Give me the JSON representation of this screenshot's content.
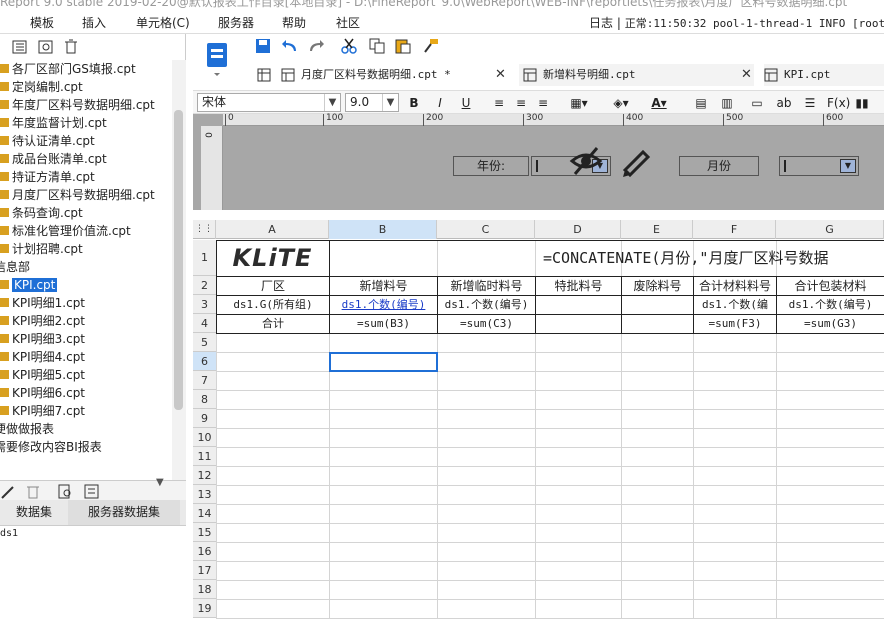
{
  "titlebar": {
    "text": "Report 9.0 stable 2019-02-20@默认报表工作目录[本地目录] - D:\\FineReport_9.0\\WebReport\\WEB-INF\\reportlets\\任务报表\\月度厂区料号数据明细.cpt"
  },
  "menu": {
    "items": [
      "模板",
      "插入",
      "单元格(C)",
      "服务器",
      "帮助",
      "社区"
    ]
  },
  "log": {
    "label": "日志",
    "sep": "|",
    "text": "正常:11:50:32 pool-1-thread-1 INFO [root]"
  },
  "tree": {
    "items": [
      {
        "label": "各厂区部门GS填报.cpt",
        "type": "file"
      },
      {
        "label": "定岗编制.cpt",
        "type": "file"
      },
      {
        "label": "年度厂区料号数据明细.cpt",
        "type": "file"
      },
      {
        "label": "年度监督计划.cpt",
        "type": "file"
      },
      {
        "label": "待认证清单.cpt",
        "type": "file"
      },
      {
        "label": "成品台账清单.cpt",
        "type": "file"
      },
      {
        "label": "持证方清单.cpt",
        "type": "file"
      },
      {
        "label": "月度厂区料号数据明细.cpt",
        "type": "file"
      },
      {
        "label": "条码查询.cpt",
        "type": "file"
      },
      {
        "label": "标准化管理价值流.cpt",
        "type": "file"
      },
      {
        "label": "计划招聘.cpt",
        "type": "file"
      },
      {
        "label": "信息部",
        "type": "folder"
      },
      {
        "label": "KPI.cpt",
        "type": "file",
        "selected": true
      },
      {
        "label": "KPI明细1.cpt",
        "type": "file"
      },
      {
        "label": "KPI明细2.cpt",
        "type": "file"
      },
      {
        "label": "KPI明细3.cpt",
        "type": "file"
      },
      {
        "label": "KPI明细4.cpt",
        "type": "file"
      },
      {
        "label": "KPI明细5.cpt",
        "type": "file"
      },
      {
        "label": "KPI明细6.cpt",
        "type": "file"
      },
      {
        "label": "KPI明细7.cpt",
        "type": "file"
      },
      {
        "label": "便做做报表",
        "type": "folder"
      },
      {
        "label": "需要修改内容BI报表",
        "type": "folder"
      }
    ]
  },
  "datasets": {
    "tab_template": "数据集",
    "tab_server": "服务器数据集",
    "items": [
      "ds1"
    ]
  },
  "doc_tabs": [
    {
      "label": "月度厂区料号数据明细.cpt *"
    },
    {
      "label": "新增料号明细.cpt"
    },
    {
      "label": "KPI.cpt"
    }
  ],
  "format": {
    "font": "宋体",
    "size": "9.0"
  },
  "ruler": {
    "ticks": [
      "0",
      "100",
      "200",
      "300",
      "400",
      "500",
      "600"
    ],
    "left_tick": "0"
  },
  "params": {
    "year_label": "年份:",
    "month_label": "月份"
  },
  "sheet": {
    "columns": [
      "A",
      "B",
      "C",
      "D",
      "E",
      "F",
      "G"
    ],
    "rows": [
      "1",
      "2",
      "3",
      "4",
      "5",
      "6",
      "7",
      "8",
      "9",
      "10",
      "11",
      "12",
      "13",
      "14",
      "15",
      "16",
      "17",
      "18",
      "19"
    ],
    "logo": "KLiTE",
    "title_formula": "=CONCATENATE(月份,\"月度厂区料号数据",
    "headers": [
      "厂区",
      "新增料号",
      "新增临时料号",
      "特批料号",
      "废除料号",
      "合计材料料号",
      "合计包装材料"
    ],
    "row3": [
      "ds1.G(所有组)",
      "ds1.个数(编号)",
      "ds1.个数(编号)",
      "",
      "",
      "ds1.个数(编",
      "ds1.个数(编号)"
    ],
    "row4": [
      "合计",
      "=sum(B3)",
      "=sum(C3)",
      "",
      "",
      "=sum(F3)",
      "=sum(G3)"
    ]
  },
  "colors": {
    "accent": "#1f6fd6",
    "selection": "#1f6fd6",
    "param_bg": "#a7a7a7",
    "link": "#1a3cc8"
  }
}
